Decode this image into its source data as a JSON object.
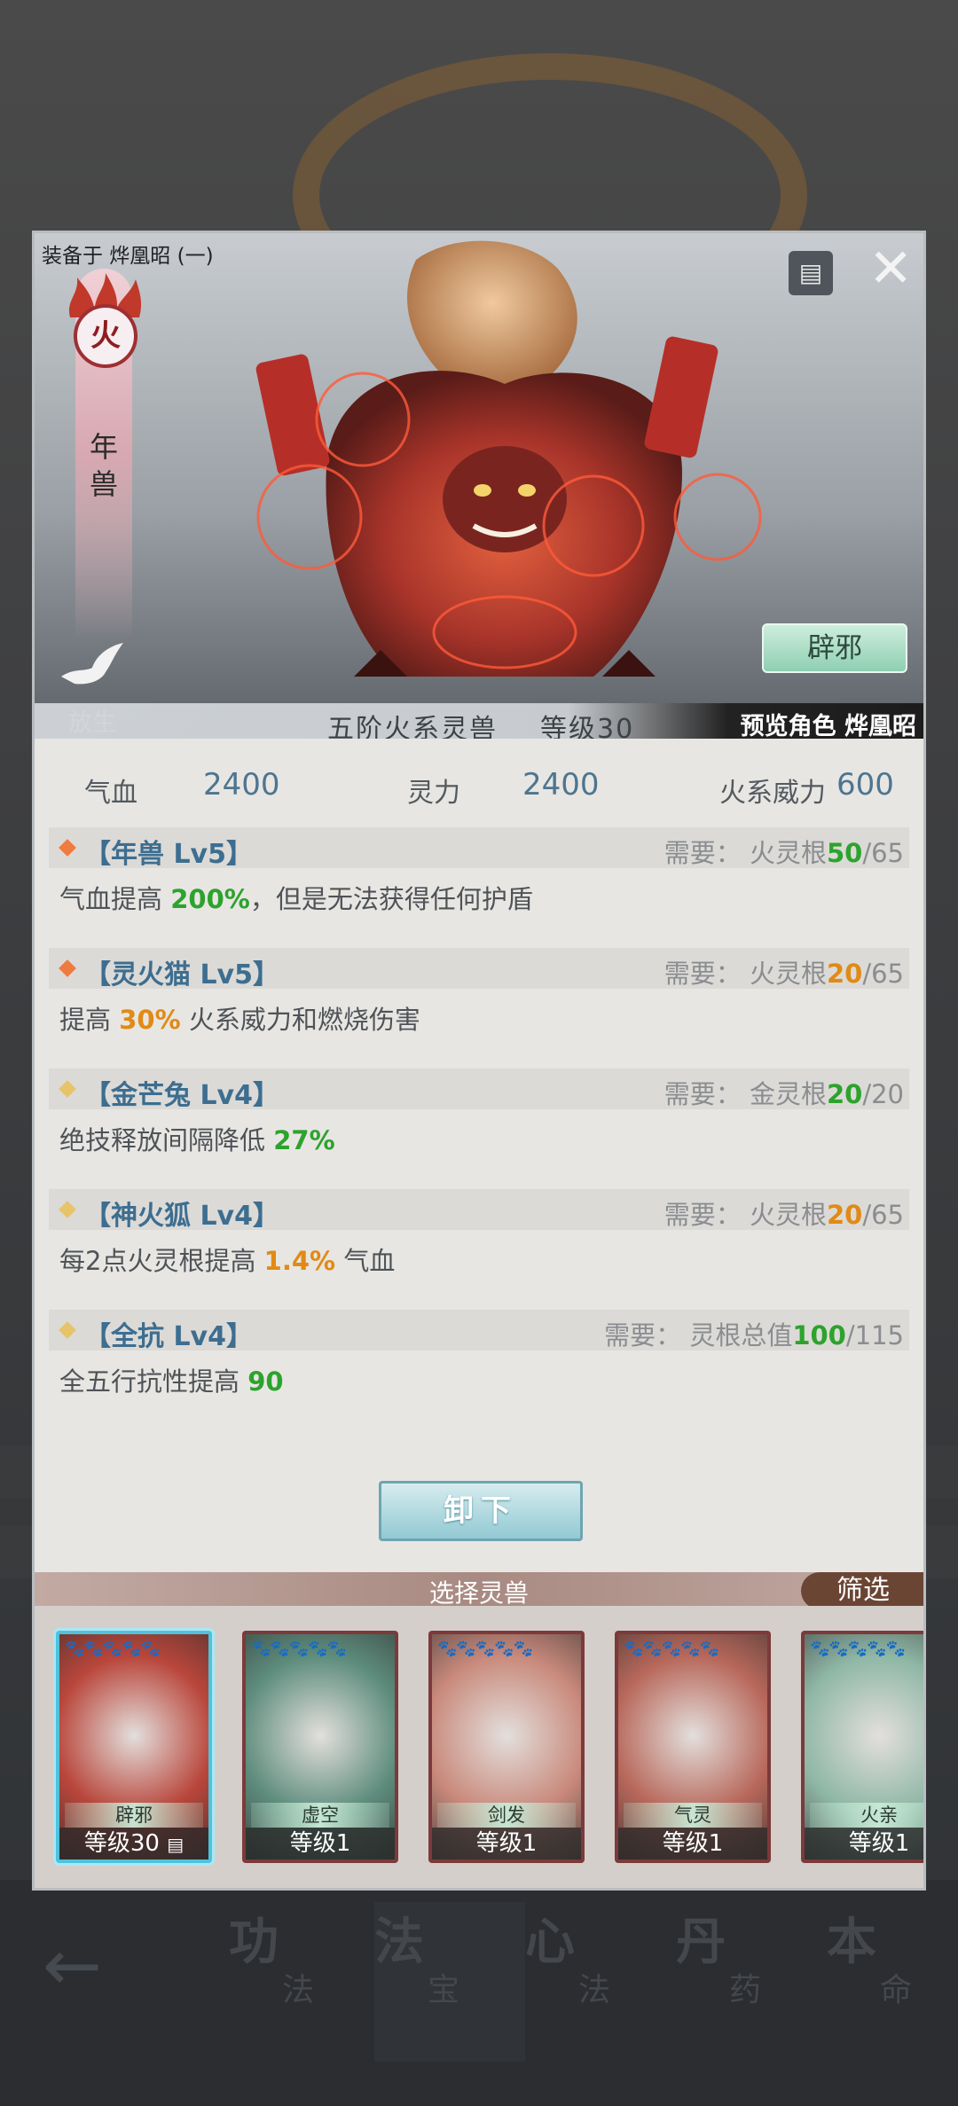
{
  "equip": {
    "label": "装备于 烨凰昭 (一)"
  },
  "element": {
    "char": "火",
    "beast_name": "年兽"
  },
  "release": {
    "label": "放生"
  },
  "pixie_button": {
    "label": "辟邪"
  },
  "tier": {
    "text": "五阶火系灵兽",
    "level": "等级30",
    "preview": "预览角色 烨凰昭"
  },
  "stats": {
    "hp_label": "气血",
    "hp_value": "2400",
    "spirit_label": "灵力",
    "spirit_value": "2400",
    "fire_label": "火系威力",
    "fire_value": "600"
  },
  "skills": [
    {
      "name": "【年兽 Lv5】",
      "req_prefix": "需要： 火灵根",
      "req_cur": "50",
      "req_max": "/65",
      "cur_color": "green",
      "desc_pre": "气血提高 ",
      "desc_val": "200%",
      "desc_post": "，但是无法获得任何护盾",
      "val_color": "green",
      "diamond": "#f07b3f"
    },
    {
      "name": "【灵火猫 Lv5】",
      "req_prefix": "需要： 火灵根",
      "req_cur": "20",
      "req_max": "/65",
      "cur_color": "orange",
      "desc_pre": "提高 ",
      "desc_val": "30%",
      "desc_post": " 火系威力和燃烧伤害",
      "val_color": "orange",
      "diamond": "#f07b3f"
    },
    {
      "name": "【金芒兔 Lv4】",
      "req_prefix": "需要： 金灵根",
      "req_cur": "20",
      "req_max": "/20",
      "cur_color": "green",
      "desc_pre": "绝技释放间隔降低 ",
      "desc_val": "27%",
      "desc_post": "",
      "val_color": "green",
      "diamond": "#e7c46a"
    },
    {
      "name": "【神火狐 Lv4】",
      "req_prefix": "需要： 火灵根",
      "req_cur": "20",
      "req_max": "/65",
      "cur_color": "orange",
      "desc_pre": "每2点火灵根提高 ",
      "desc_val": "1.4%",
      "desc_post": " 气血",
      "val_color": "orange",
      "diamond": "#e7c46a"
    },
    {
      "name": "【全抗 Lv4】",
      "req_prefix": "需要： 灵根总值",
      "req_cur": "100",
      "req_max": "/115",
      "cur_color": "green",
      "desc_pre": "全五行抗性提高 ",
      "desc_val": "90",
      "desc_post": "",
      "val_color": "green",
      "diamond": "#e7c46a"
    }
  ],
  "unload_button": {
    "label": "卸下"
  },
  "select": {
    "title": "选择灵兽",
    "filter_label": "筛选"
  },
  "beasts": [
    {
      "name": "辟邪",
      "level": "等级30",
      "stars": "🐾🐾🐾🐾🐾",
      "bg": "#b9463b",
      "selected": true,
      "equipped_icon": true
    },
    {
      "name": "虚空",
      "level": "等级1",
      "stars": "🐾🐾🐾🐾🐾",
      "bg": "#5e8d7d",
      "selected": false
    },
    {
      "name": "剑发",
      "level": "等级1",
      "stars": "🐾🐾🐾🐾🐾",
      "bg": "#c98a7c",
      "selected": false
    },
    {
      "name": "气灵",
      "level": "等级1",
      "stars": "🐾🐾🐾🐾🐾",
      "bg": "#b8685b",
      "selected": false
    },
    {
      "name": "火亲",
      "level": "等级1",
      "stars": "🐾🐾🐾🐾🐾",
      "bg": "#8fb7a6",
      "selected": false
    }
  ],
  "nav": [
    {
      "big": "功",
      "small": "法"
    },
    {
      "big": "法",
      "small": "宝"
    },
    {
      "big": "心",
      "small": "法"
    },
    {
      "big": "丹",
      "small": "药"
    },
    {
      "big": "本",
      "small": "命"
    }
  ],
  "icons": {
    "back": "arrow-left-icon",
    "close": "close-icon",
    "chest": "chest-icon",
    "dove": "dove-icon",
    "flame": "flame-icon"
  }
}
